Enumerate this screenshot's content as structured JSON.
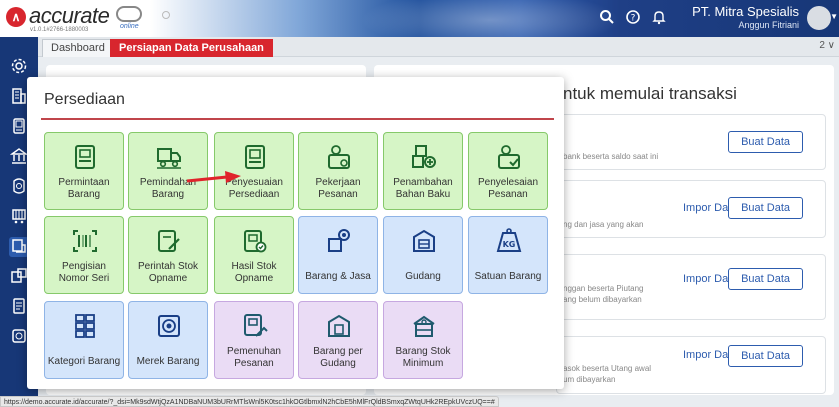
{
  "header": {
    "logo_text": "accurate",
    "logo_sub": "online",
    "version": "v1.0.1#2766-1880003",
    "company_name": "PT. Mitra Spesialis",
    "user_name": "Anggun Fitriani",
    "brand_color": "#d8262e",
    "nav_color": "#173777"
  },
  "tabs": {
    "dashboard": "Dashboard",
    "active": "Persiapan Data Perusahaan",
    "right_indicator": "2 ∨"
  },
  "sidebar": {
    "icons": [
      "gear-icon",
      "building-icon",
      "phone-icon",
      "bank-icon",
      "money-icon",
      "cart-icon",
      "inventory-icon",
      "ledger-icon",
      "report-icon",
      "dashboard-icon"
    ]
  },
  "background": {
    "heading": "ntuk memulai transaksi",
    "rows": [
      {
        "desc": "bank beserta saldo saat ini",
        "buat": "Buat Data",
        "impor": ""
      },
      {
        "desc": "ng dan jasa yang akan",
        "buat": "Buat Data",
        "impor": "Impor Data"
      },
      {
        "desc": "nggan beserta Piutang\nang belum dibayarkan",
        "buat": "Buat Data",
        "impor": "Impor Data"
      },
      {
        "desc": "asok beserta Utang awal\num dibayarkan",
        "buat": "Buat Data",
        "impor": "Impor Data"
      }
    ]
  },
  "popup": {
    "title": "Persediaan",
    "tiles": [
      {
        "line1": "Permintaan",
        "line2": "Barang",
        "color": "green",
        "icon": "clipboard-icon"
      },
      {
        "line1": "Pemindahan",
        "line2": "Barang",
        "color": "green",
        "icon": "truck-icon"
      },
      {
        "line1": "Penyesuaian",
        "line2": "Persediaan",
        "color": "green",
        "icon": "adjust-icon"
      },
      {
        "line1": "Pekerjaan",
        "line2": "Pesanan",
        "color": "green",
        "icon": "work-order-icon"
      },
      {
        "line1": "Penambahan",
        "line2": "Bahan Baku",
        "color": "green",
        "icon": "add-material-icon"
      },
      {
        "line1": "Penyelesaian",
        "line2": "Pesanan",
        "color": "green",
        "icon": "finish-order-icon"
      },
      {
        "line1": "Pengisian",
        "line2": "Nomor Seri",
        "color": "green",
        "icon": "barcode-icon"
      },
      {
        "line1": "Perintah Stok",
        "line2": "Opname",
        "color": "green",
        "icon": "stock-order-icon"
      },
      {
        "line1": "Hasil Stok",
        "line2": "Opname",
        "color": "green",
        "icon": "stock-result-icon"
      },
      {
        "line1": "Barang & Jasa",
        "line2": "",
        "color": "blue",
        "icon": "item-service-icon"
      },
      {
        "line1": "Gudang",
        "line2": "",
        "color": "blue",
        "icon": "warehouse-icon"
      },
      {
        "line1": "Satuan Barang",
        "line2": "",
        "color": "blue",
        "icon": "kg-icon"
      },
      {
        "line1": "Kategori Barang",
        "line2": "",
        "color": "blue",
        "icon": "category-icon"
      },
      {
        "line1": "Merek Barang",
        "line2": "",
        "color": "blue",
        "icon": "brand-icon"
      },
      {
        "line1": "Pemenuhan",
        "line2": "Pesanan",
        "color": "purple",
        "icon": "fulfill-icon"
      },
      {
        "line1": "Barang per",
        "line2": "Gudang",
        "color": "purple",
        "icon": "item-warehouse-icon"
      },
      {
        "line1": "Barang Stok",
        "line2": "Minimum",
        "color": "purple",
        "icon": "min-stock-icon"
      }
    ],
    "kg_label": "KG"
  },
  "status_url": "https://demo.accurate.id/accurate/?_dsi=Mk9sdWtjQzA1NDBaNUM3bURrMTlsWnl5K0tsc1hkOGtlbmxlN2hCbE5hMlFrQldBSmxqZWtqUHk2REpkUVczUQ==#"
}
